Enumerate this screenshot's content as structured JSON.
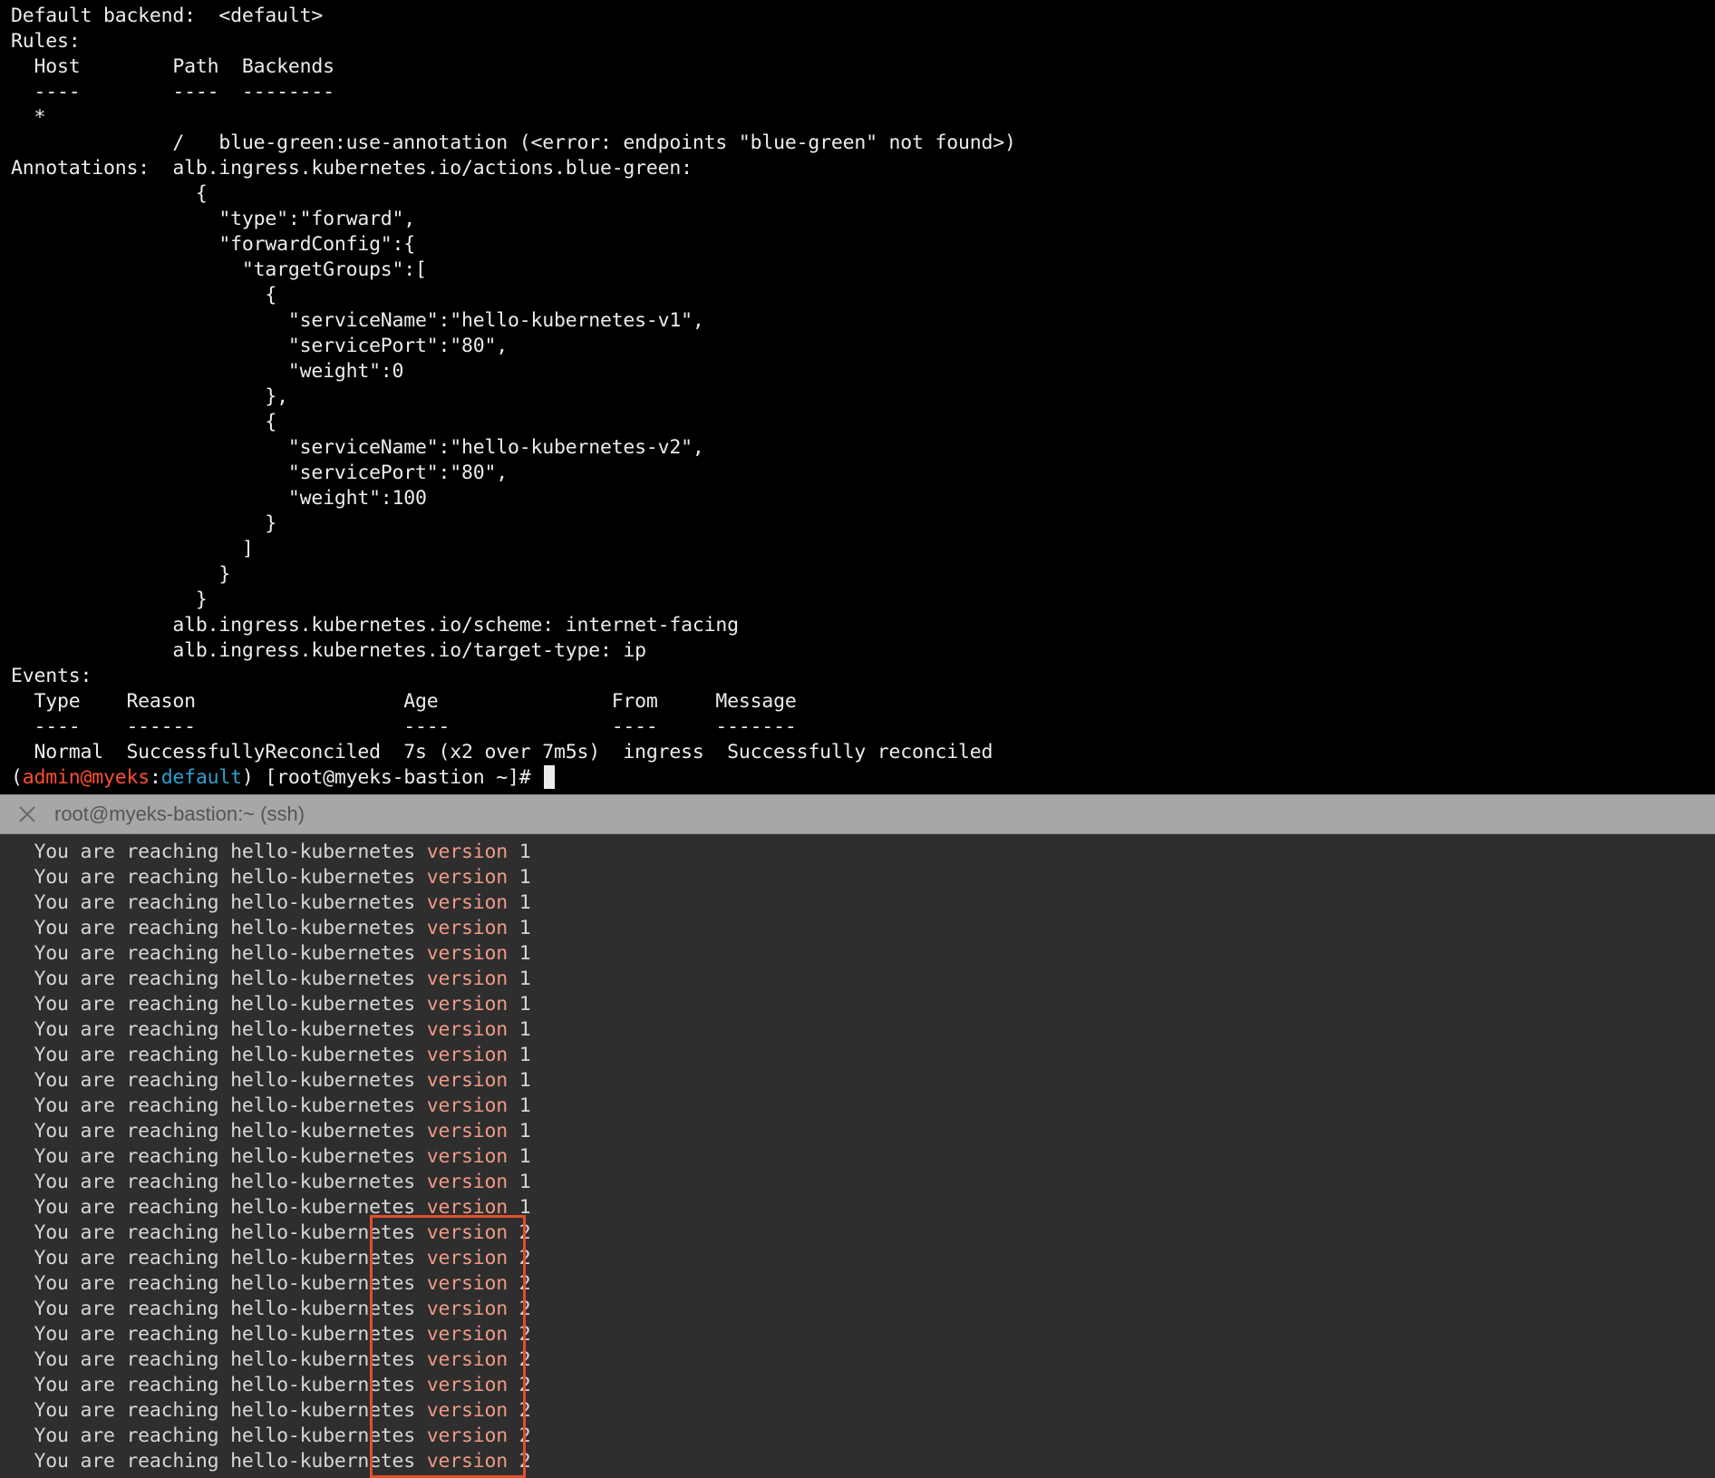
{
  "top_terminal": {
    "lines": [
      "Default backend:  <default>",
      "Rules:",
      "  Host        Path  Backends",
      "  ----        ----  --------",
      "  *",
      "              /   blue-green:use-annotation (<error: endpoints \"blue-green\" not found>)",
      "Annotations:  alb.ingress.kubernetes.io/actions.blue-green:",
      "                {",
      "                  \"type\":\"forward\",",
      "                  \"forwardConfig\":{",
      "                    \"targetGroups\":[",
      "                      {",
      "                        \"serviceName\":\"hello-kubernetes-v1\",",
      "                        \"servicePort\":\"80\",",
      "                        \"weight\":0",
      "                      },",
      "                      {",
      "                        \"serviceName\":\"hello-kubernetes-v2\",",
      "                        \"servicePort\":\"80\",",
      "                        \"weight\":100",
      "                      }",
      "                    ]",
      "                  }",
      "                }",
      "              alb.ingress.kubernetes.io/scheme: internet-facing",
      "              alb.ingress.kubernetes.io/target-type: ip",
      "Events:",
      "  Type    Reason                  Age               From     Message",
      "  ----    ------                  ----              ----     -------",
      "  Normal  SuccessfullyReconciled  7s (x2 over 7m5s)  ingress  Successfully reconciled"
    ],
    "prompt": {
      "open": "(",
      "user": "admin@myeks",
      "colon": ":",
      "namespace": "default",
      "rest": ") [root@myeks-bastion ~]# "
    },
    "colors": {
      "user": "#ff4f2f",
      "namespace": "#2ca0cf",
      "background": "#000000"
    }
  },
  "tab": {
    "title": "root@myeks-bastion:~ (ssh)",
    "close_icon": "close-icon"
  },
  "bottom_terminal": {
    "line_prefix": "  You are reaching hello-kubernetes ",
    "keyword": "version",
    "output_versions": [
      "1",
      "1",
      "1",
      "1",
      "1",
      "1",
      "1",
      "1",
      "1",
      "1",
      "1",
      "1",
      "1",
      "1",
      "1",
      "2",
      "2",
      "2",
      "2",
      "2",
      "2",
      "2",
      "2",
      "2",
      "2"
    ],
    "colors": {
      "keyword": "#ef9a85",
      "highlight_border": "#e2502a",
      "background": "#2e2e2e"
    }
  }
}
